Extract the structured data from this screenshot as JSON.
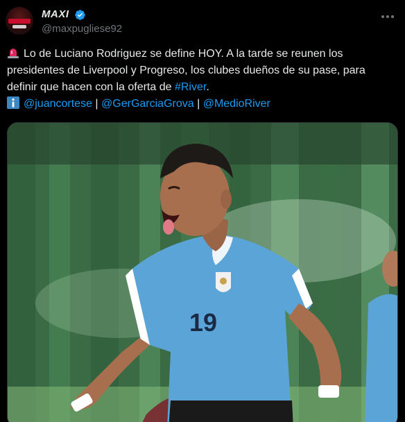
{
  "tweet": {
    "author": {
      "display_name": "MAXI",
      "handle": "@maxpugliese92",
      "verified": true,
      "avatar_icon": "avatar-image"
    },
    "text": {
      "line1_prefix": "Lo de Luciano Rodriguez se define HOY. A la tarde se reunen los",
      "line2": "presidentes de Liverpool y Progreso, los clubes dueños de su pase, para",
      "line3_prefix": "definir que hacen con la oferta de ",
      "hashtag": "#River",
      "line3_suffix": ".",
      "mentions": [
        "@juancortese",
        "@GerGarciaGrova",
        "@MedioRiver"
      ],
      "separator": "|"
    },
    "icons": {
      "line1": "rotating-light-icon",
      "line4": "information-icon"
    },
    "media": {
      "type": "photo",
      "icon": "football-player-celebrating-photo",
      "jersey_number": "19"
    },
    "colors": {
      "background": "#000000",
      "text": "#e7e9ea",
      "secondary": "#71767b",
      "link": "#1d9bf0",
      "jersey": "#5ba4d8"
    }
  }
}
